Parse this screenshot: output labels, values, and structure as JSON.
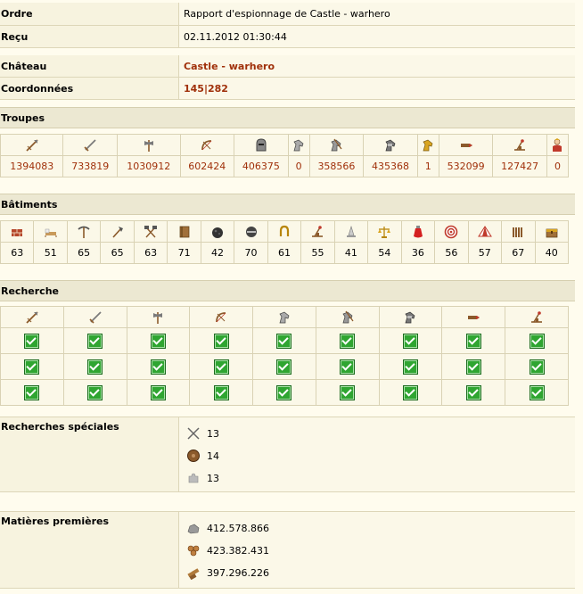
{
  "header": {
    "order_label": "Ordre",
    "order_value": "Rapport d'espionnage de Castle - warhero",
    "received_label": "Reçu",
    "received_value": "02.11.2012 01:30:44"
  },
  "castle": {
    "castle_label": "Château",
    "castle_value": "Castle - warhero",
    "coords_label": "Coordonnées",
    "coords_value": "145|282"
  },
  "troops": {
    "title": "Troupes",
    "units": [
      {
        "icon": "spear-icon",
        "value": "1394083"
      },
      {
        "icon": "sword-icon",
        "value": "733819"
      },
      {
        "icon": "axe-icon",
        "value": "1030912"
      },
      {
        "icon": "bow-icon",
        "value": "602424"
      },
      {
        "icon": "helmet-icon",
        "value": "406375"
      },
      {
        "icon": "horse-icon",
        "value": "0"
      },
      {
        "icon": "horse-lancer-icon",
        "value": "358566"
      },
      {
        "icon": "armored-horse-icon",
        "value": "435368"
      },
      {
        "icon": "golden-horse-icon",
        "value": "1"
      },
      {
        "icon": "ram-icon",
        "value": "532099"
      },
      {
        "icon": "catapult-icon",
        "value": "127427"
      },
      {
        "icon": "nobleman-icon",
        "value": "0"
      }
    ]
  },
  "buildings": {
    "title": "Bâtiments",
    "items": [
      {
        "icon": "brick-icon",
        "value": "63"
      },
      {
        "icon": "bed-icon",
        "value": "51"
      },
      {
        "icon": "pickaxe-icon",
        "value": "65"
      },
      {
        "icon": "woodaxe-icon",
        "value": "65"
      },
      {
        "icon": "hammers-icon",
        "value": "63"
      },
      {
        "icon": "book-icon",
        "value": "71"
      },
      {
        "icon": "ore-icon",
        "value": "42"
      },
      {
        "icon": "helmet-dark-icon",
        "value": "70"
      },
      {
        "icon": "horseshoe-icon",
        "value": "61"
      },
      {
        "icon": "catapult-icon",
        "value": "55"
      },
      {
        "icon": "tower-icon",
        "value": "41"
      },
      {
        "icon": "scales-icon",
        "value": "54"
      },
      {
        "icon": "potion-icon",
        "value": "36"
      },
      {
        "icon": "target-icon",
        "value": "56"
      },
      {
        "icon": "tent-icon",
        "value": "57"
      },
      {
        "icon": "palisade-icon",
        "value": "67"
      },
      {
        "icon": "chest-icon",
        "value": "40"
      }
    ]
  },
  "research": {
    "title": "Recherche",
    "icons": [
      "spear-icon",
      "sword-icon",
      "axe-icon",
      "bow-icon",
      "horse-icon",
      "horse-lancer-icon",
      "armored-horse-icon",
      "ram-icon",
      "catapult-icon"
    ],
    "rows": 3
  },
  "special_research": {
    "title": "Recherches spéciales",
    "items": [
      {
        "icon": "crossed-swords-icon",
        "value": "13"
      },
      {
        "icon": "shield-icon",
        "value": "14"
      },
      {
        "icon": "puzzle-icon",
        "value": "13"
      }
    ]
  },
  "resources": {
    "title": "Matières premières",
    "items": [
      {
        "icon": "stone-icon",
        "value": "412.578.866"
      },
      {
        "icon": "wood-icon",
        "value": "423.382.431"
      },
      {
        "icon": "iron-icon",
        "value": "397.296.226"
      }
    ]
  },
  "colors": {
    "background": "#fffcee",
    "row": "#f7f3df",
    "accent_red": "#a0300a",
    "check_green": "#2fa531"
  }
}
